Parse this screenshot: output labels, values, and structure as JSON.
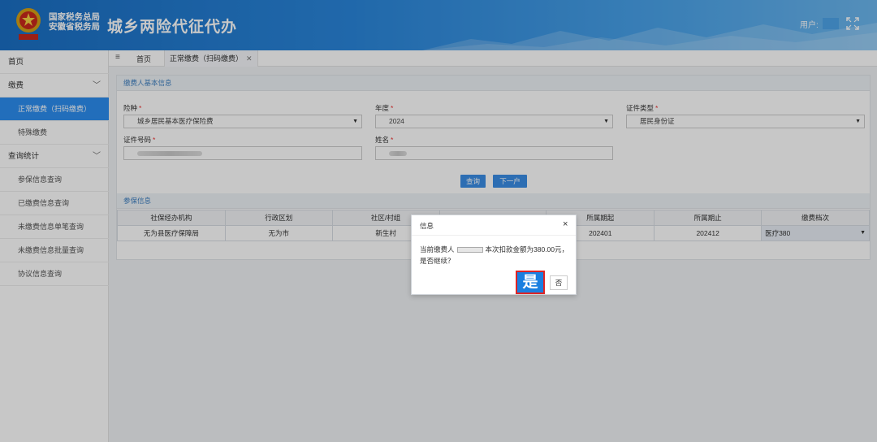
{
  "header": {
    "org_line1": "国家税务总局",
    "org_line2": "安徽省税务局",
    "app_title": "城乡两险代征代办",
    "user_prefix": "用户:"
  },
  "sidebar": {
    "items": [
      {
        "label": "首页"
      },
      {
        "label": "缴费"
      },
      {
        "label": "正常缴费（扫码缴费）"
      },
      {
        "label": "特殊缴费"
      },
      {
        "label": "查询统计"
      },
      {
        "label": "参保信息查询"
      },
      {
        "label": "已缴费信息查询"
      },
      {
        "label": "未缴费信息单笔查询"
      },
      {
        "label": "未缴费信息批量查询"
      },
      {
        "label": "协议信息查询"
      }
    ]
  },
  "tabs": {
    "menu_icon": "≡",
    "home": "首页",
    "active": "正常缴费（扫码缴费）",
    "close": "✕"
  },
  "form": {
    "section_title": "缴费人基本信息",
    "fields": {
      "insurance_type": {
        "label": "险种",
        "value": "城乡居民基本医疗保险费"
      },
      "year": {
        "label": "年度",
        "value": "2024"
      },
      "id_type": {
        "label": "证件类型",
        "value": "居民身份证"
      },
      "id_number": {
        "label": "证件号码"
      },
      "name": {
        "label": "姓名"
      }
    },
    "query_button": "查询",
    "next_button": "下一户"
  },
  "insured": {
    "section_title": "参保信息",
    "columns": [
      "社保经办机构",
      "行政区划",
      "社区/村组",
      "",
      "所属期起",
      "所属期止",
      "缴费档次"
    ],
    "rows": [
      [
        "无为县医疗保障局",
        "无为市",
        "新生村",
        "",
        "202401",
        "202412",
        "医疗380"
      ]
    ]
  },
  "dialog": {
    "title": "信息",
    "close": "×",
    "message_prefix": "当前缴费人",
    "message_suffix": "本次扣款金额为380.00元，",
    "message_line2": "是否继续？",
    "yes": "是",
    "no": "否"
  },
  "colors": {
    "header_blue": "#2a86db",
    "active_blue": "#2c8df0",
    "highlight_red": "#e02424"
  }
}
